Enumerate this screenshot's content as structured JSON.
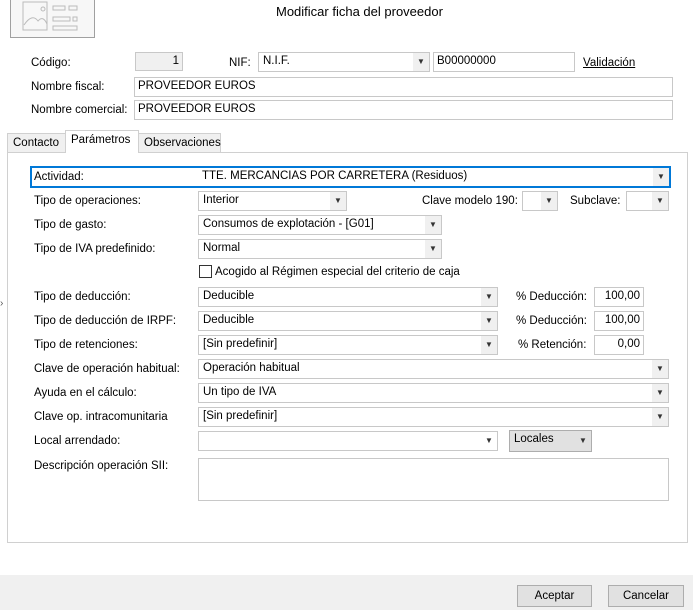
{
  "header": {
    "title": "Modificar ficha del proveedor",
    "image_icon": "image-placeholder-icon"
  },
  "general": {
    "codigo_label": "Código:",
    "codigo_value": "1",
    "nif_label": "NIF:",
    "nif_type": "N.I.F.",
    "nif_value": "B00000000",
    "validacion_link": "Validación",
    "nombre_fiscal_label": "Nombre fiscal:",
    "nombre_fiscal_value": "PROVEEDOR EUROS",
    "nombre_comercial_label": "Nombre comercial:",
    "nombre_comercial_value": "PROVEEDOR EUROS"
  },
  "tabs": [
    {
      "label": "Contacto"
    },
    {
      "label": "Parámetros",
      "active": true
    },
    {
      "label": "Observaciones"
    }
  ],
  "params": {
    "actividad_label": "Actividad:",
    "actividad_value": "TTE. MERCANCIAS POR CARRETERA (Residuos)",
    "tipo_operaciones_label": "Tipo de operaciones:",
    "tipo_operaciones_value": "Interior",
    "clave190_label": "Clave modelo 190:",
    "clave190_value": "",
    "subclave_label": "Subclave:",
    "subclave_value": "",
    "tipo_gasto_label": "Tipo de gasto:",
    "tipo_gasto_value": "Consumos de explotación - [G01]",
    "tipo_iva_label": "Tipo de IVA predefinido:",
    "tipo_iva_value": "Normal",
    "criterio_caja_label": "Acogido al Régimen especial del criterio de caja",
    "criterio_caja_checked": false,
    "tipo_deduccion_label": "Tipo de deducción:",
    "tipo_deduccion_value": "Deducible",
    "pct_deduccion_label": "% Deducción:",
    "pct_deduccion_value": "100,00",
    "tipo_deduccion_irpf_label": "Tipo de deducción de IRPF:",
    "tipo_deduccion_irpf_value": "Deducible",
    "pct_deduccion_irpf_label": "% Deducción:",
    "pct_deduccion_irpf_value": "100,00",
    "tipo_retenciones_label": "Tipo de retenciones:",
    "tipo_retenciones_value": "[Sin predefinir]",
    "pct_retencion_label": "% Retención:",
    "pct_retencion_value": "0,00",
    "clave_habitual_label": "Clave de operación habitual:",
    "clave_habitual_value": "Operación habitual",
    "ayuda_label": "Ayuda en el cálculo:",
    "ayuda_value": "Un tipo de IVA",
    "intracom_label": "Clave op. intracomunitaria",
    "intracom_value": "[Sin predefinir]",
    "local_label": "Local arrendado:",
    "local_value": "",
    "locales_button": "Locales",
    "descripcion_label": "Descripción operación SII:",
    "descripcion_value": ""
  },
  "footer": {
    "accept": "Aceptar",
    "cancel": "Cancelar"
  },
  "colors": {
    "focus": "#0078d7",
    "footer_bg": "#f0f0f0"
  }
}
